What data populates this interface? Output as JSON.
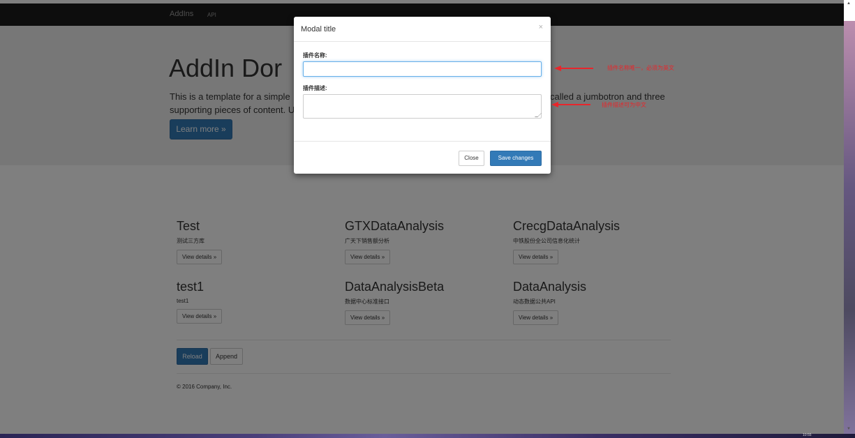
{
  "navbar": {
    "brand": "AddIns",
    "api_link": "API"
  },
  "jumbotron": {
    "title": "AddIn Dor",
    "text_line1": "This is a template for a simple",
    "text_line1_end": "called a jumbotron and three",
    "text_line2": "supporting pieces of content. U",
    "learn_more": "Learn more »"
  },
  "addins": [
    {
      "title": "Test",
      "desc": "测试三方库",
      "btn": "View details »"
    },
    {
      "title": "GTXDataAnalysis",
      "desc": "广天下销售额分析",
      "btn": "View details »"
    },
    {
      "title": "CrecgDataAnalysis",
      "desc": "中铁股份全公司信息化统计",
      "btn": "View details »"
    },
    {
      "title": "test1",
      "desc": "test1",
      "btn": "View details »"
    },
    {
      "title": "DataAnalysisBeta",
      "desc": "数据中心标准接口",
      "btn": "View details »"
    },
    {
      "title": "DataAnalysis",
      "desc": "动态数据公共API",
      "btn": "View details »"
    }
  ],
  "actions": {
    "reload": "Reload",
    "append": "Append"
  },
  "footer": {
    "text": "© 2016 Company, Inc."
  },
  "modal": {
    "title": "Modal title",
    "close_x": "×",
    "name_label": "插件名称:",
    "desc_label": "插件描述:",
    "close_btn": "Close",
    "save_btn": "Save changes"
  },
  "annotations": {
    "name_note": "插件名称唯一，必须为英文",
    "desc_note": "插件描述可为中文"
  },
  "taskbar": {
    "clock": "10:55"
  },
  "colors": {
    "primary": "#337ab7",
    "navbar": "#1b1b1b",
    "jumbotron": "#eeeeee",
    "annotation": "#e8262b"
  },
  "icons": {
    "close": "close-icon",
    "resize": "resize-grip-icon"
  }
}
